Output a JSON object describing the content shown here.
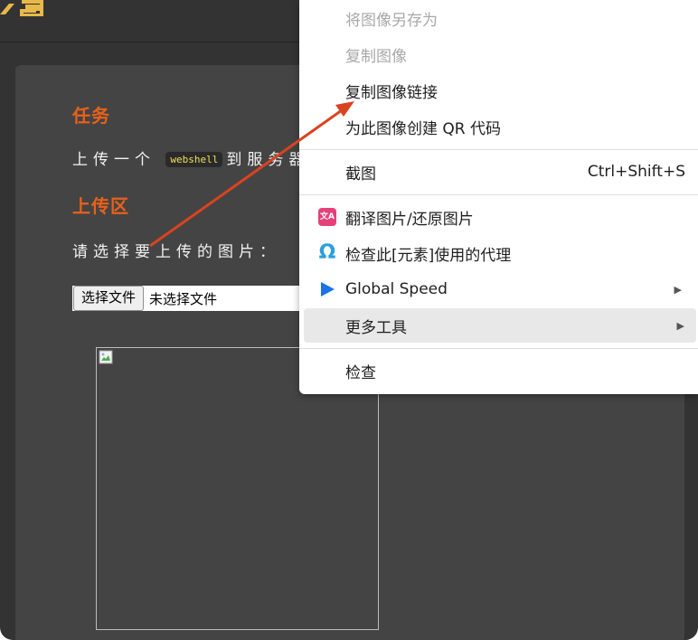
{
  "page": {
    "task_heading": "任务",
    "task_text_before": "上传一个",
    "task_code": "webshell",
    "task_text_after": "到服务器",
    "upload_heading": "上传区",
    "upload_prompt": "请选择要上传的图片：",
    "file_button_label": "选择文件",
    "file_status": "未选择文件"
  },
  "context_menu": {
    "items": [
      {
        "label": "将图像另存为",
        "disabled": true
      },
      {
        "label": "复制图像",
        "disabled": true
      },
      {
        "label": "复制图像链接",
        "disabled": false
      },
      {
        "label": "为此图像创建 QR 代码",
        "disabled": false
      },
      {
        "label": "截图",
        "shortcut": "Ctrl+Shift+S"
      },
      {
        "label": "翻译图片/还原图片",
        "icon": "translate-icon"
      },
      {
        "label": "检查此[元素]使用的代理",
        "icon": "omega-icon"
      },
      {
        "label": "Global Speed",
        "icon": "play-icon",
        "submenu": true
      },
      {
        "label": "更多工具",
        "submenu": true,
        "highlighted": true
      },
      {
        "label": "检查"
      }
    ]
  },
  "colors": {
    "accent_orange": "#e8611a",
    "page_bg": "#333333",
    "panel_bg": "#444444",
    "annotation_arrow": "#d9431f"
  }
}
